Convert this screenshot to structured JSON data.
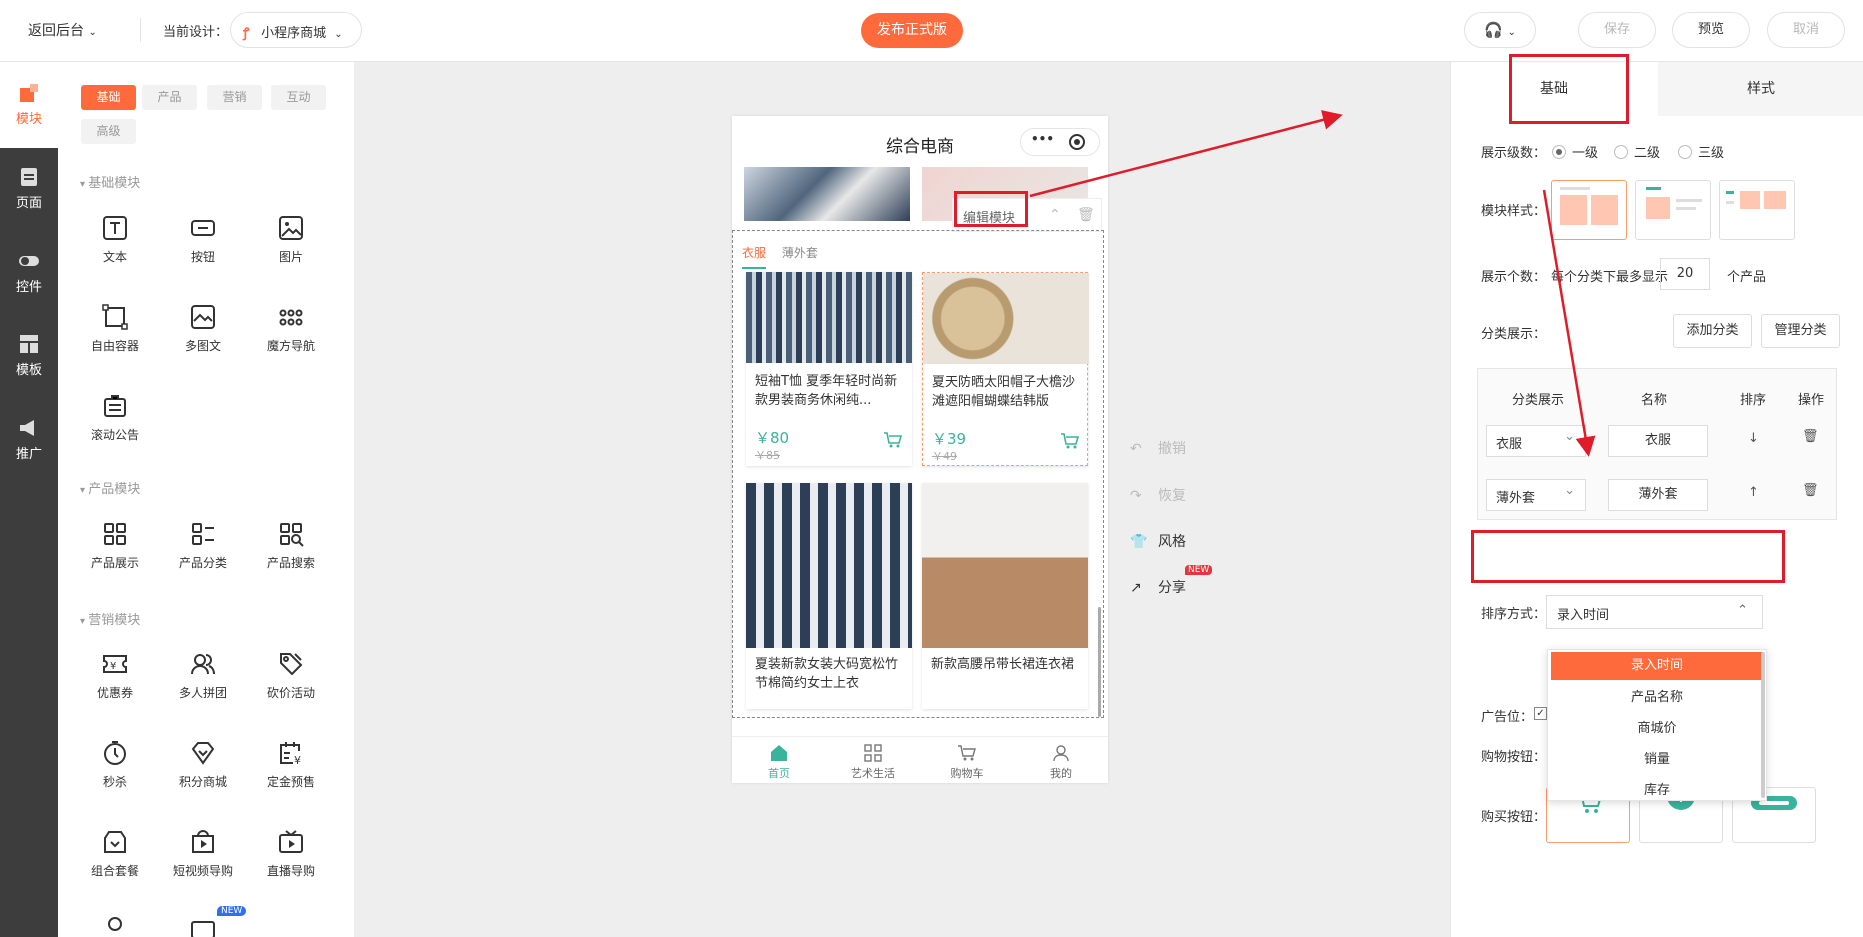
{
  "topbar": {
    "back_label": "返回后台",
    "current_design_label": "当前设计：",
    "design_name": "小程序商城",
    "publish_label": "发布正式版",
    "save_label": "保存",
    "preview_label": "预览",
    "cancel_label": "取消"
  },
  "leftnav": {
    "items": [
      {
        "label": "模块",
        "icon": "modules-icon"
      },
      {
        "label": "页面",
        "icon": "page-icon"
      },
      {
        "label": "控件",
        "icon": "toggle-icon"
      },
      {
        "label": "模板",
        "icon": "template-icon"
      },
      {
        "label": "推广",
        "icon": "megaphone-icon"
      }
    ]
  },
  "modpanel": {
    "tags": [
      "基础",
      "产品",
      "营销",
      "互动",
      "高级"
    ],
    "sections": [
      {
        "title": "基础模块",
        "items": [
          "文本",
          "按钮",
          "图片",
          "自由容器",
          "多图文",
          "魔方导航",
          "滚动公告"
        ]
      },
      {
        "title": "产品模块",
        "items": [
          "产品展示",
          "产品分类",
          "产品搜索"
        ]
      },
      {
        "title": "营销模块",
        "items": [
          "优惠券",
          "多人拼团",
          "砍价活动",
          "秒杀",
          "积分商城",
          "定金预售",
          "组合套餐",
          "短视频导购",
          "直播导购"
        ]
      }
    ],
    "new_badge": "NEW"
  },
  "phone": {
    "title": "综合电商",
    "edit_module_label": "编辑模块",
    "tabs": [
      "衣服",
      "薄外套"
    ],
    "products": [
      {
        "title": "短袖T恤 夏季年轻时尚新款男装商务休闲纯...",
        "price": "￥80",
        "orig": "￥85"
      },
      {
        "title": "夏天防晒太阳帽子大檐沙滩遮阳帽蝴蝶结韩版",
        "price": "￥39",
        "orig": "￥49"
      },
      {
        "title": "夏装新款女装大码宽松竹节棉简约女士上衣",
        "price": "",
        "orig": ""
      },
      {
        "title": "新款高腰吊带长裙连衣裙",
        "price": "",
        "orig": ""
      }
    ],
    "tabbar": [
      "首页",
      "艺术生活",
      "购物车",
      "我的"
    ]
  },
  "side_actions": {
    "undo": "撤销",
    "redo": "恢复",
    "style": "风格",
    "share": "分享",
    "share_badge": "NEW"
  },
  "rpanel": {
    "tab_basic": "基础",
    "tab_style": "样式",
    "level_label": "展示级数：",
    "levels": [
      "一级",
      "二级",
      "三级"
    ],
    "module_style_label": "模块样式：",
    "count_label": "展示个数：",
    "count_prefix": "每个分类下最多显示",
    "count_value": "20",
    "count_suffix": "个产品",
    "category_label": "分类展示：",
    "add_category": "添加分类",
    "manage_category": "管理分类",
    "table_headers": [
      "分类展示",
      "名称",
      "排序",
      "操作"
    ],
    "rows": [
      {
        "category": "衣服",
        "name": "衣服",
        "sort": "↓"
      },
      {
        "category": "薄外套",
        "name": "薄外套",
        "sort": "↑"
      }
    ],
    "sort_label": "排序方式：",
    "sort_value": "录入时间",
    "sort_options": [
      "录入时间",
      "产品名称",
      "商城价",
      "销量",
      "库存"
    ],
    "ad_label": "广告位：",
    "cart_label": "购物按钮：",
    "buy_label": "购买按钮："
  },
  "colors": {
    "accent": "#ff6a3d",
    "green": "#3ab39c",
    "annotation_red": "#e11c2a",
    "sidebar_dark": "#3d3d3d"
  }
}
